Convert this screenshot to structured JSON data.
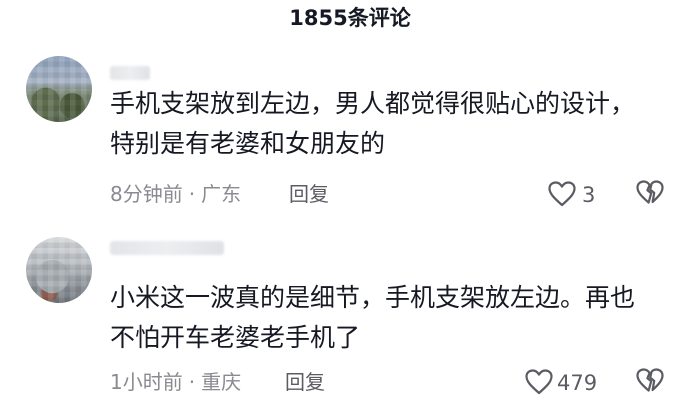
{
  "header": {
    "title": "1855条评论"
  },
  "comments": [
    {
      "text_line1": "手机支架放到左边，男人都觉得很贴心的设计，",
      "text_line2": "特别是有老婆和女朋友的",
      "time": "8分钟前",
      "separator": "·",
      "location": "广东",
      "reply_label": "回复",
      "like_count": "3"
    },
    {
      "text_line1": "小米这一波真的是细节，手机支架放左边。再也",
      "text_line2": "不怕开车老婆老手机了",
      "time": "1小时前",
      "separator": "·",
      "location": "重庆",
      "reply_label": "回复",
      "like_count": "479"
    }
  ],
  "icons": {
    "like": "heart-outline-icon",
    "dislike": "broken-heart-icon"
  },
  "colors": {
    "text_primary": "#161823",
    "text_meta": "#8a8b91",
    "icon": "#5b5c63"
  }
}
